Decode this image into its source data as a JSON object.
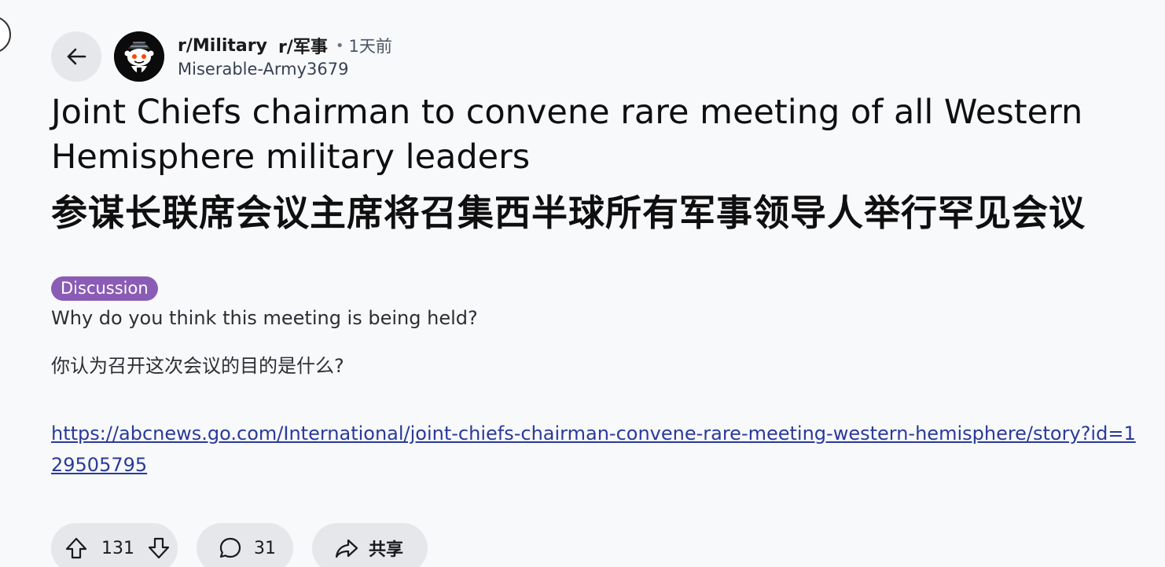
{
  "post": {
    "subreddit": "r/Military",
    "subreddit_cn": "r/军事",
    "separator": "•",
    "time": "1天前",
    "author": "Miserable-Army3679",
    "title_en": "Joint Chiefs chairman to convene rare meeting of all Western Hemisphere military leaders",
    "title_cn": "参谋长联席会议主席将召集西半球所有军事领导人举行罕见会议",
    "flair": "Discussion",
    "flair_color": "#8a5cb5",
    "body_en": "Why do you think this meeting is being held?",
    "body_cn": "你认为召开这次会议的目的是什么?",
    "link": "https://abcnews.go.com/International/joint-chiefs-chairman-convene-rare-meeting-western-hemisphere/story?id=129505795"
  },
  "actions": {
    "votes": "131",
    "comments": "31",
    "share_label": "共享"
  },
  "icons": {
    "back": "arrow-left-icon",
    "upvote": "arrow-up-icon",
    "downvote": "arrow-down-icon",
    "comment": "speech-bubble-icon",
    "share": "share-arrow-icon"
  },
  "colors": {
    "link": "#2a3a99",
    "pill_background": "#e5e7eb",
    "page_background": "#f8f9fb"
  }
}
